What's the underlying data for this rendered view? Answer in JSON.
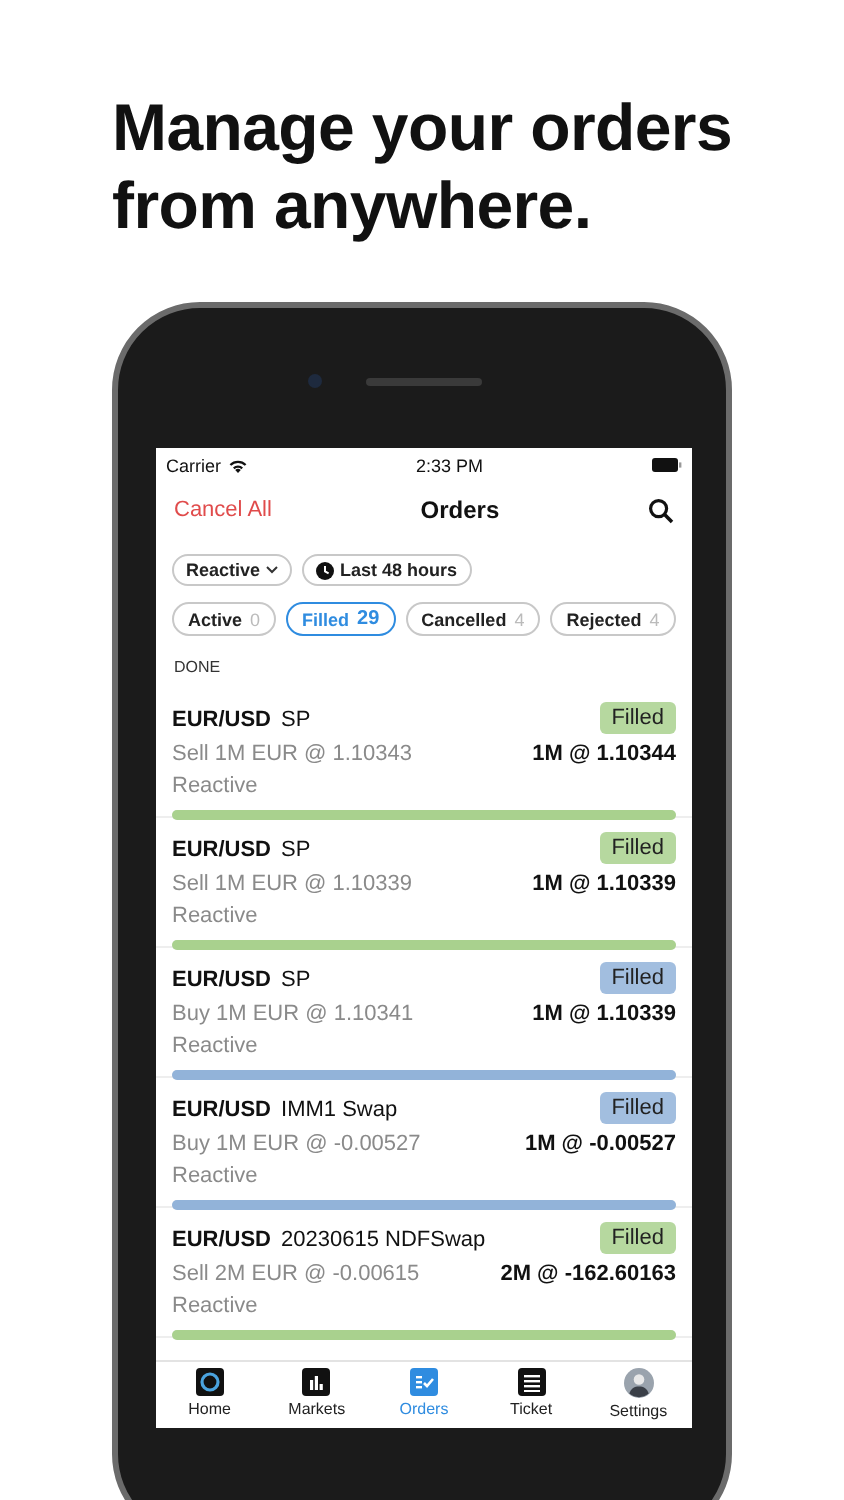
{
  "headline": [
    "Manage your orders",
    "from anywhere."
  ],
  "status_bar": {
    "carrier": "Carrier",
    "time": "2:33 PM"
  },
  "nav": {
    "left": "Cancel All",
    "title": "Orders"
  },
  "filters": [
    {
      "label": "Reactive",
      "kind": "dropdown"
    },
    {
      "label": "Last 48 hours",
      "kind": "clock"
    }
  ],
  "tabs": [
    {
      "label": "Active",
      "count": "0",
      "selected": false
    },
    {
      "label": "Filled",
      "count": "29",
      "selected": true
    },
    {
      "label": "Cancelled",
      "count": "4",
      "selected": false
    },
    {
      "label": "Rejected",
      "count": "4",
      "selected": false
    }
  ],
  "section": "DONE",
  "orders": [
    {
      "pair": "EUR/USD",
      "tenor": "SP",
      "status": "Filled",
      "color": "#a9d18e",
      "description": "Sell 1M EUR @ 1.10343",
      "fill": "1M @ 1.10344",
      "source": "Reactive",
      "level": 1
    },
    {
      "pair": "EUR/USD",
      "tenor": "SP",
      "status": "Filled",
      "color": "#a9d18e",
      "description": "Sell 1M EUR @ 1.10339",
      "fill": "1M @ 1.10339",
      "source": "Reactive",
      "level": 1
    },
    {
      "pair": "EUR/USD",
      "tenor": "SP",
      "status": "Filled",
      "color": "#92b3d9",
      "description": "Buy 1M EUR @ 1.10341",
      "fill": "1M @ 1.10339",
      "source": "Reactive",
      "level": 1
    },
    {
      "pair": "EUR/USD",
      "tenor": "IMM1 Swap",
      "status": "Filled",
      "color": "#92b3d9",
      "description": "Buy 1M EUR @ -0.00527",
      "fill": "1M @ -0.00527",
      "source": "Reactive",
      "level": 1
    },
    {
      "pair": "EUR/USD",
      "tenor": "20230615 NDFSwap",
      "status": "Filled",
      "color": "#a9d18e",
      "description": "Sell 2M EUR @ -0.00615",
      "fill": "2M @ -162.60163",
      "source": "Reactive",
      "level": 1
    }
  ],
  "tab_bar": [
    {
      "label": "Home",
      "kind": "home",
      "selected": false
    },
    {
      "label": "Markets",
      "kind": "markets",
      "selected": false
    },
    {
      "label": "Orders",
      "kind": "orders",
      "selected": true
    },
    {
      "label": "Ticket",
      "kind": "ticket",
      "selected": false
    },
    {
      "label": "Settings",
      "kind": "avatar",
      "selected": false
    }
  ]
}
